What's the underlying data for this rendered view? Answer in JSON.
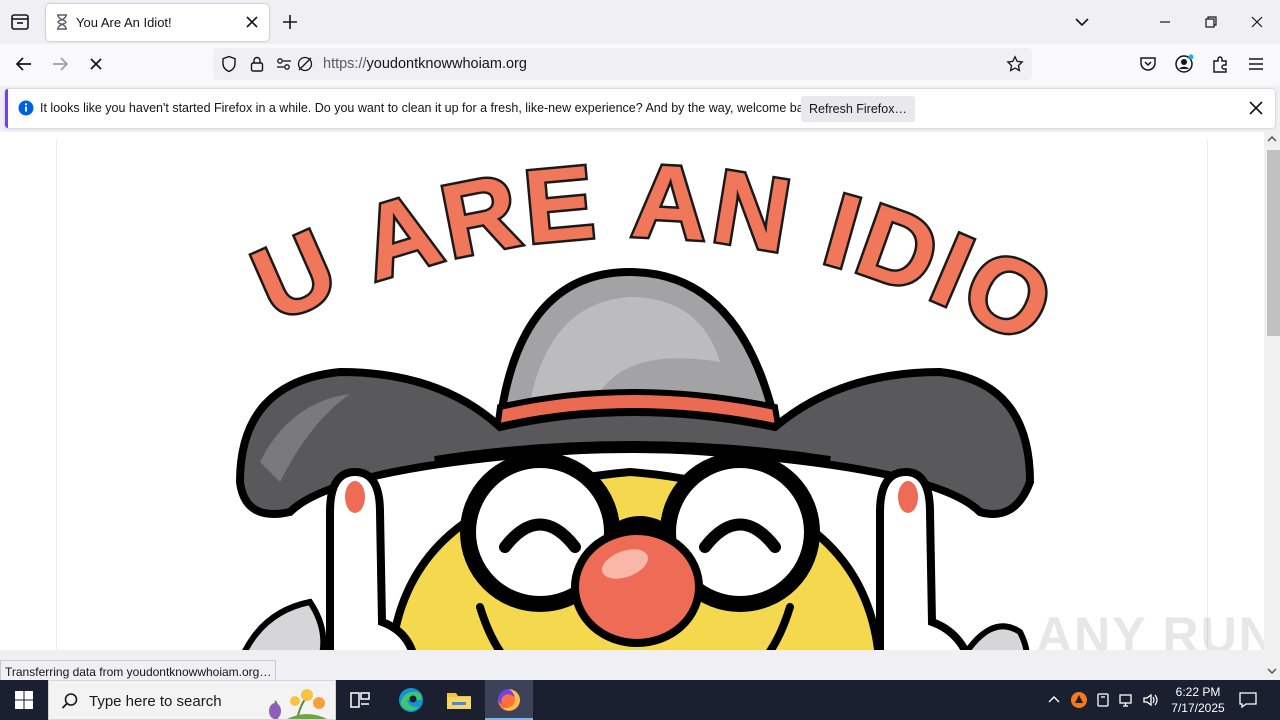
{
  "browser": {
    "tab": {
      "title": "You Are An Idiot!"
    },
    "url": {
      "scheme": "https://",
      "host": "youdontknowwhoiam.org"
    }
  },
  "notification": {
    "message": "It looks like you haven't started Firefox in a while. Do you want to clean it up for a fresh, like-new experience? And by the way, welcome back!",
    "button": "Refresh Firefox…"
  },
  "page": {
    "headline": "YOU ARE AN IDIOT!"
  },
  "status": {
    "text": "Transferring data from youdontknowwhoiam.org…"
  },
  "watermark": "ANY RUN",
  "taskbar": {
    "search_placeholder": "Type here to search",
    "time": "6:22 PM",
    "date": "7/17/2025"
  },
  "colors": {
    "accent": "#7542e5",
    "headline": "#f0775a",
    "taskbar": "#1b2030"
  }
}
